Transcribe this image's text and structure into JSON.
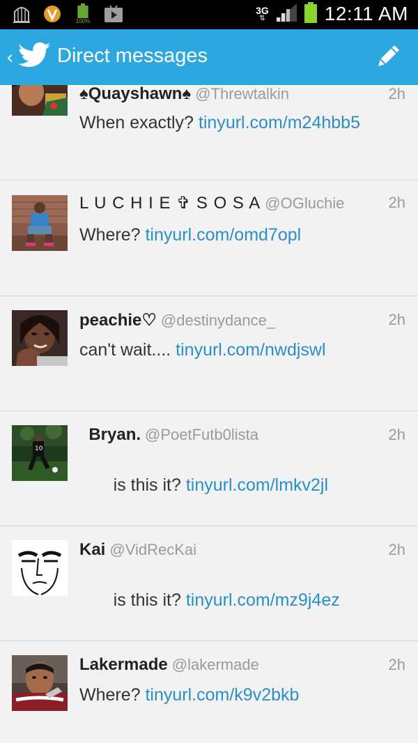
{
  "status_bar": {
    "battery_label": "100%",
    "network": "3G",
    "time": "12:11 AM"
  },
  "header": {
    "title": "Direct messages"
  },
  "messages": [
    {
      "name": "♠Quayshawn♠",
      "handle": "@Threwtalkin",
      "time": "2h",
      "text": "When exactly? ",
      "link": "tinyurl.com/m24hbb5"
    },
    {
      "name": "L U C H I E ✞ S O S A",
      "handle": "@OGluchie",
      "time": "2h",
      "text": "Where? ",
      "link": "tinyurl.com/omd7opl"
    },
    {
      "name": "peachie♡",
      "handle": "@destinydance_",
      "time": "2h",
      "text": "can't wait.... ",
      "link": "tinyurl.com/nwdjswl"
    },
    {
      "name": "  Bryan.",
      "handle": "@PoetFutb0lista",
      "time": "2h",
      "text": " is this it? ",
      "link": "tinyurl.com/lmkv2jl"
    },
    {
      "name": "Kai",
      "handle": "@VidRecKai",
      "time": "2h",
      "text": " is this it? ",
      "link": "tinyurl.com/mz9j4ez"
    },
    {
      "name": "Lakermade",
      "handle": "@lakermade",
      "time": "2h",
      "text": "Where? ",
      "link": "tinyurl.com/k9v2bkb"
    }
  ],
  "colors": {
    "action_bar": "#2ca7e0",
    "link": "#2b8fc7",
    "background": "#f2f2f2"
  }
}
